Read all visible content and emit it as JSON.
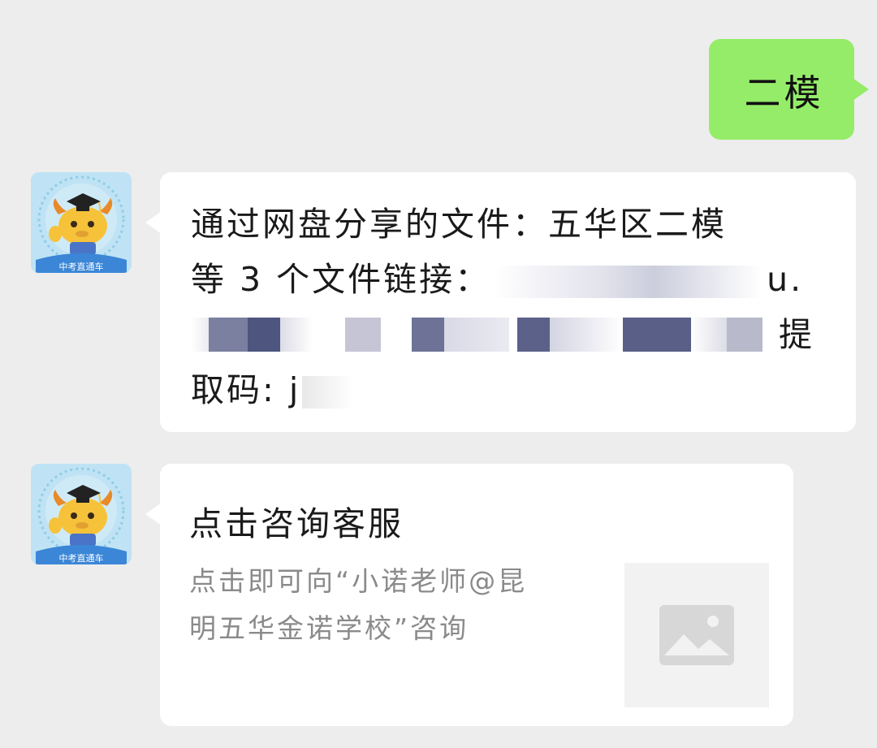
{
  "outgoing_message": {
    "text": "二模"
  },
  "incoming_message": {
    "line1": "通过网盘分享的文件：五华区二模",
    "line2_prefix": "等 3 个文件链接：",
    "line2_suffix": "u.",
    "line3_suffix": "提",
    "line4_prefix": "取码: j"
  },
  "card_message": {
    "title": "点击咨询客服",
    "description_line1": "点击即可向“小诺老师@昆",
    "description_line2": "明五华金诺学校”咨询",
    "thumbnail_icon": "image-placeholder-icon"
  },
  "avatar": {
    "badge_text": "中考直通车",
    "icon": "cartoon-ox-graduate-avatar"
  },
  "colors": {
    "background": "#ededed",
    "outgoing_bubble": "#95ec69",
    "incoming_bubble": "#ffffff",
    "secondary_text": "#8a8a8a"
  }
}
